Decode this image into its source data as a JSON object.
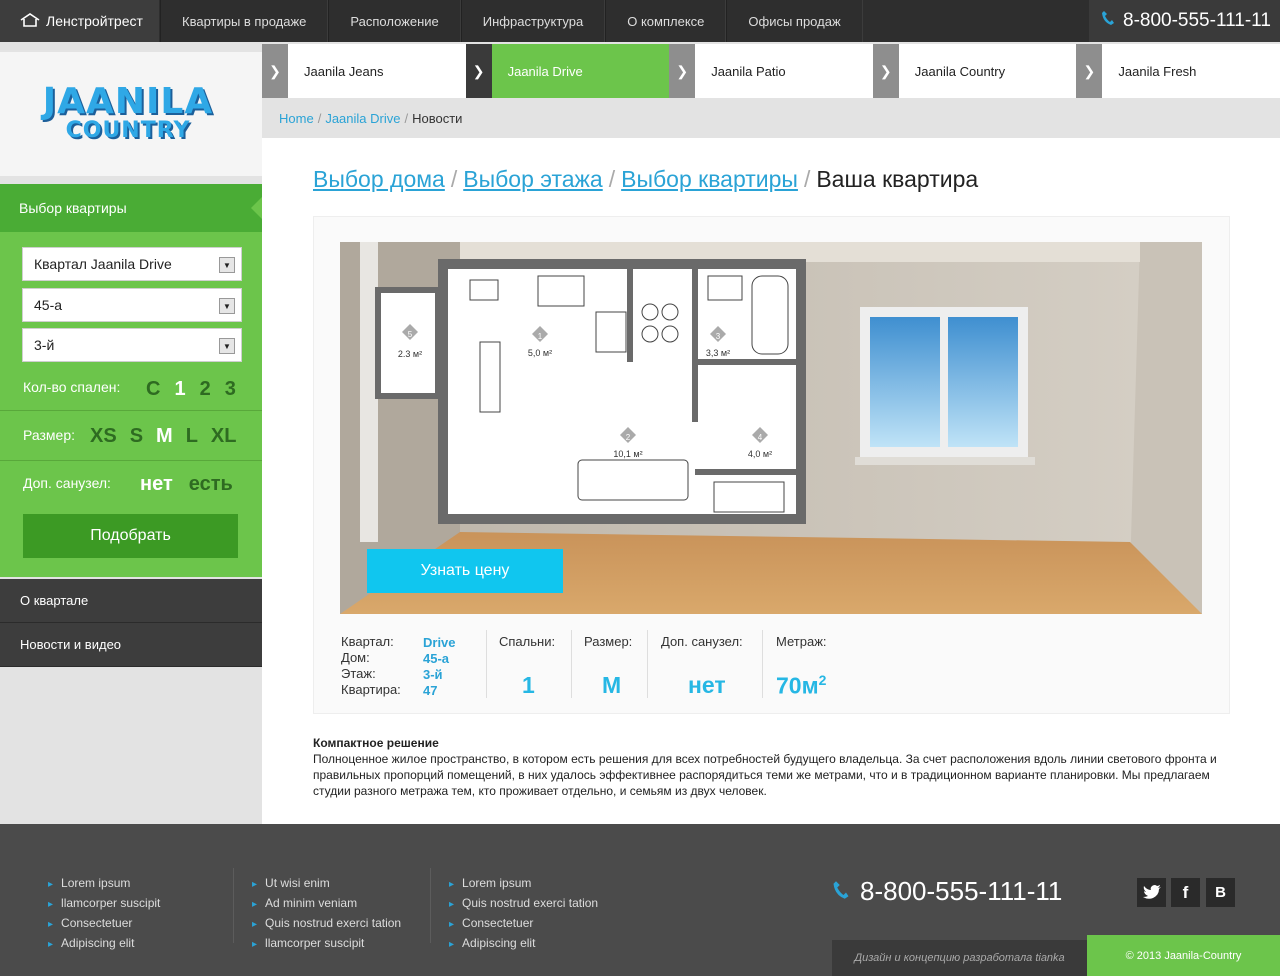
{
  "header": {
    "brand": "Ленстройтрест",
    "nav": [
      "Квартиры в продаже",
      "Расположение",
      "Инфраструктура",
      "О комплексе",
      "Офисы продаж"
    ],
    "phone": "8-800-555-111-11"
  },
  "logo": {
    "line1": "JAANILA",
    "line2": "COUNTRY"
  },
  "tabs": [
    "Jaanila Jeans",
    "Jaanila Drive",
    "Jaanila Patio",
    "Jaanila Country",
    "Jaanila Fresh"
  ],
  "active_tab": 1,
  "breadcrumb": {
    "home": "Home",
    "section": "Jaanila Drive",
    "current": "Новости"
  },
  "sidebar": {
    "heading": "Выбор квартиры",
    "quarter": "Квартал Jaanila Drive",
    "house": "45-а",
    "floor": "3-й",
    "bedrooms_label": "Кол-во спален:",
    "bedrooms": [
      "С",
      "1",
      "2",
      "3"
    ],
    "size_label": "Размер:",
    "sizes": [
      "XS",
      "S",
      "M",
      "L",
      "XL"
    ],
    "bath_label": "Доп. санузел:",
    "bath_options": [
      "нет",
      "есть"
    ],
    "submit": "Подобрать",
    "links": [
      "О квартале",
      "Новости и видео"
    ]
  },
  "title": {
    "step1": "Выбор дома",
    "step2": "Выбор этажа",
    "step3": "Выбор квартиры",
    "current": "Ваша квартира"
  },
  "plan": {
    "rooms": [
      {
        "num": "5",
        "area": "2.3 м²"
      },
      {
        "num": "1",
        "area": "5,0 м²"
      },
      {
        "num": "3",
        "area": "3,3 м²"
      },
      {
        "num": "2",
        "area": "10,1 м²"
      },
      {
        "num": "4",
        "area": "4,0 м²"
      }
    ]
  },
  "price_button": "Узнать цену",
  "details": {
    "quarter_label": "Квартал:",
    "quarter": "Drive",
    "house_label": "Дом:",
    "house": "45-а",
    "floor_label": "Этаж:",
    "floor": "3-й",
    "apt_label": "Квартира:",
    "apt": "47",
    "bedrooms_label": "Спальни:",
    "bedrooms": "1",
    "size_label": "Размер:",
    "size": "M",
    "bath_label": "Доп. санузел:",
    "bath": "нет",
    "area_label": "Метраж:",
    "area": "70м",
    "area_sup": "2"
  },
  "description": {
    "title": "Компактное решение",
    "text": "Полноценное жилое пространство, в котором есть решения для всех потребностей будущего владельца. За счет расположения вдоль линии светового фронта и правильных пропорций помещений, в них удалось эффективнее распорядиться теми же метрами, что и в традиционном варианте планировки. Мы предлагаем студии разного метража тем, кто проживает отдельно, и семьям из двух человек."
  },
  "footer": {
    "col1": [
      "Lorem ipsum",
      "llamcorper suscipit",
      "Consectetuer",
      "Adipiscing elit"
    ],
    "col2": [
      "Ut wisi enim",
      "Ad minim veniam",
      "Quis nostrud exerci tation",
      "llamcorper suscipit"
    ],
    "col3": [
      "Lorem ipsum",
      "Quis nostrud exerci tation",
      "Consectetuer",
      "Adipiscing elit"
    ],
    "phone": "8-800-555-111-11",
    "social": [
      "twitter-icon",
      "facebook-icon",
      "vk-icon"
    ],
    "credit": "Дизайн и концепцию разработала tianka",
    "copyright": "© 2013 Jaanila-Country"
  },
  "colors": {
    "green": "#6cc54b",
    "blue": "#2aa3d6",
    "cyan": "#10c6ef",
    "dark": "#2e2e2e"
  }
}
